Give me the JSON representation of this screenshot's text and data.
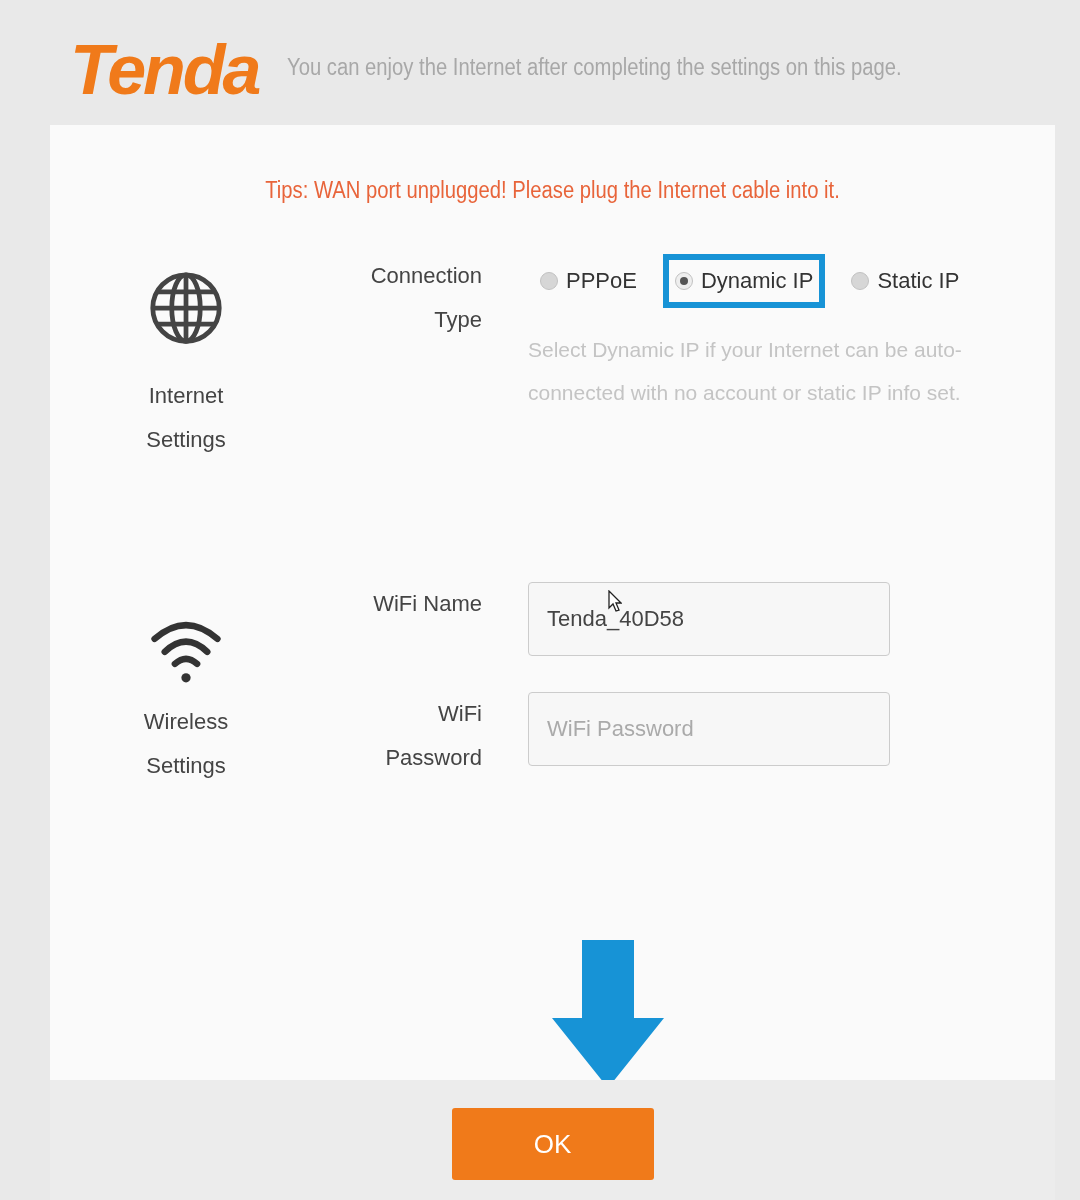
{
  "header": {
    "logo": "Tenda",
    "tagline": "You can enjoy the Internet after completing the settings on this page."
  },
  "tip": "Tips: WAN port unplugged! Please plug the Internet cable into it.",
  "internet": {
    "title": "Internet Settings",
    "label": "Connection Type",
    "options": [
      {
        "label": "PPPoE",
        "selected": false,
        "highlighted": false
      },
      {
        "label": "Dynamic IP",
        "selected": true,
        "highlighted": true
      },
      {
        "label": "Static IP",
        "selected": false,
        "highlighted": false
      }
    ],
    "hint": "Select Dynamic IP if your Internet can be auto-connected with no account or static IP info set."
  },
  "wireless": {
    "title": "Wireless Settings",
    "fields": [
      {
        "label": "WiFi Name",
        "value": "Tenda_40D58"
      },
      {
        "label": "WiFi Password",
        "placeholder": "WiFi Password"
      }
    ]
  },
  "ok_button": "OK"
}
